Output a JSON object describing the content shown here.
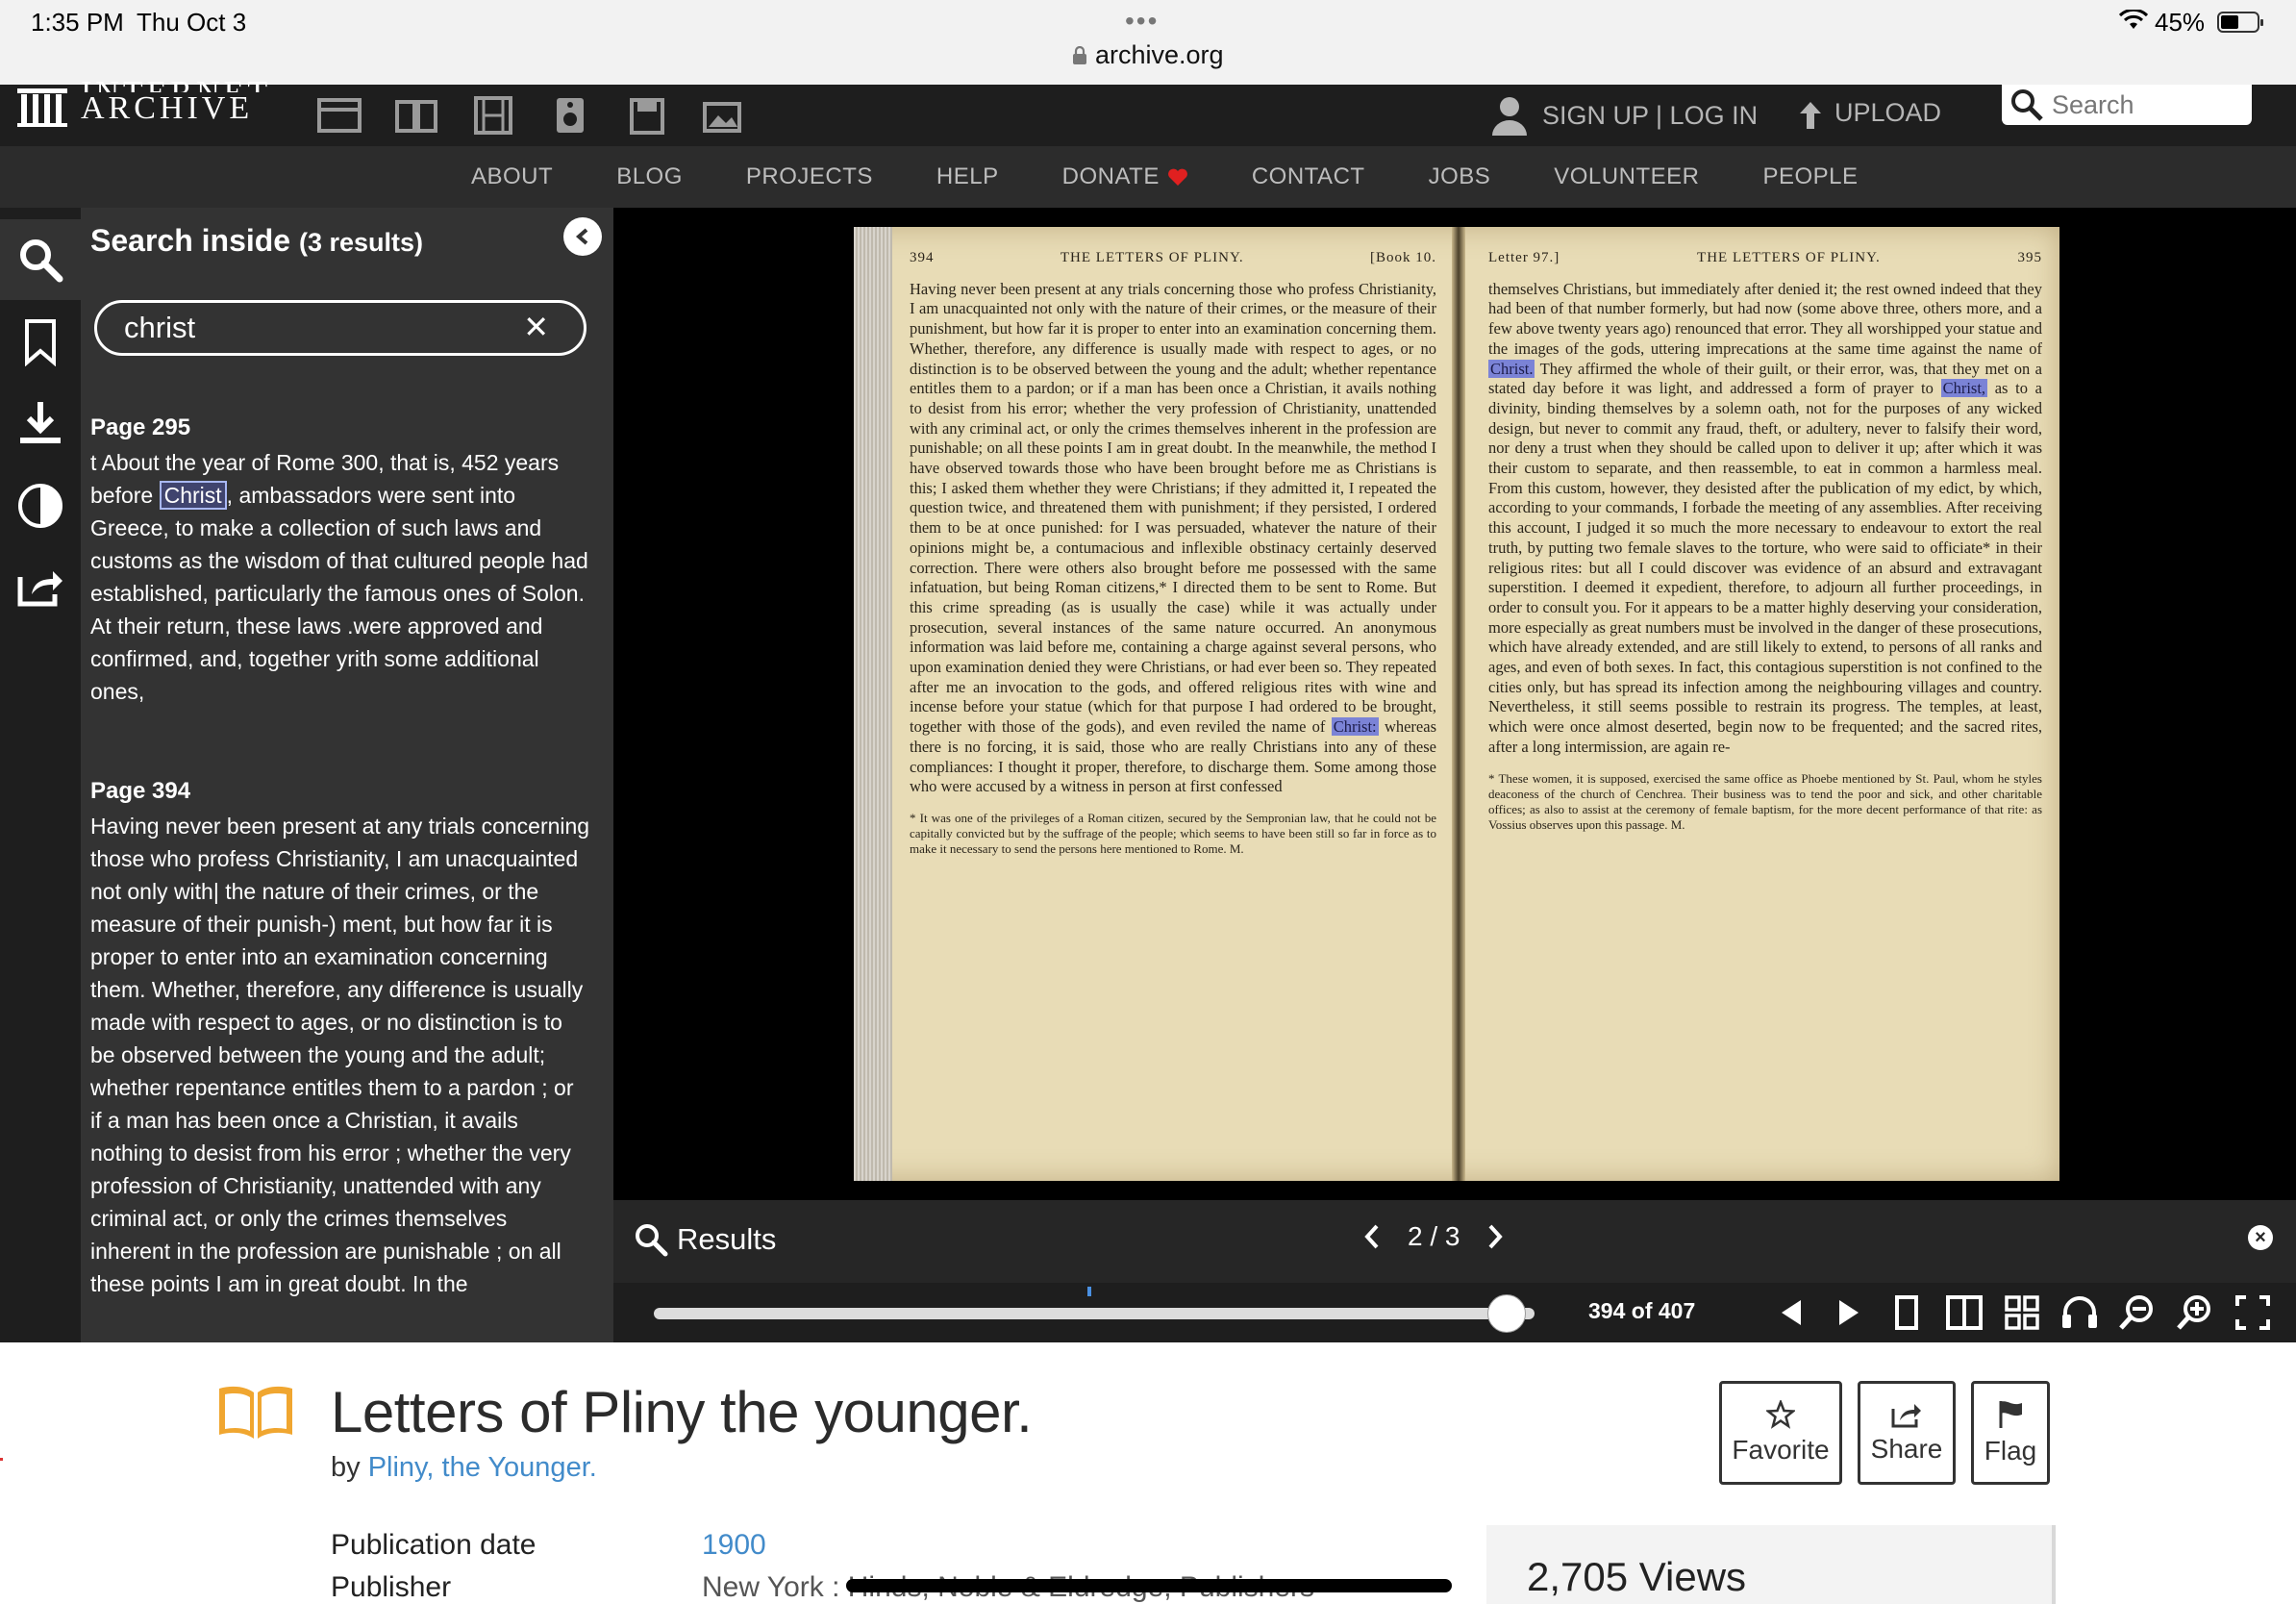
{
  "status_bar": {
    "time": "1:35 PM",
    "date": "Thu Oct 3",
    "url": "archive.org",
    "battery": "45%"
  },
  "ia_header": {
    "logo_line1": "INTERNET",
    "logo_line2": "ARCHIVE",
    "media_icons": [
      "web-icon",
      "texts-icon",
      "video-icon",
      "audio-icon",
      "software-icon",
      "images-icon"
    ],
    "signup_login": "SIGN UP | LOG IN",
    "upload": "UPLOAD",
    "search_placeholder": "Search"
  },
  "nav": {
    "items": [
      "ABOUT",
      "BLOG",
      "PROJECTS",
      "HELP",
      "DONATE",
      "CONTACT",
      "JOBS",
      "VOLUNTEER",
      "PEOPLE"
    ]
  },
  "sidebar": {
    "icons": [
      "search-icon",
      "bookmark-icon",
      "download-icon",
      "contrast-icon",
      "share-icon"
    ]
  },
  "search_panel": {
    "title": "Search inside",
    "count": "(3 results)",
    "query": "christ",
    "results": [
      {
        "page": "Page 295",
        "pre": "t About the year of Rome 300, that is, 452 years before ",
        "match": "Christ",
        "post": ", ambassadors were sent into Greece, to make a collection of such laws and customs as the wisdom of that cultured people had established, particularly the famous ones of Solon. At their return, these laws .were approved and confirmed, and, together yrith some additional ones,"
      },
      {
        "page": "Page 394",
        "text": "Having never been present at any trials concerning those who profess Christianity, I am unacquainted not only with| the nature of their crimes, or the measure of their punish-) ment, but how far it is proper to enter into an examination concerning them. Whether, therefore, any difference is usually made with respect to ages, or no distinction is to be observed between the young and the adult; whether repentance entitles them to a pardon ; or if a man has been once a Christian, it avails nothing to desist from his error ; whether the very profession of Christianity, unattended with any criminal act, or only the crimes themselves inherent in the profession are punishable ; on all these points I am in great doubt. In the"
      }
    ]
  },
  "book": {
    "left_page": {
      "num": "394",
      "running_head": "THE LETTERS OF PLINY.",
      "book_label": "[Book 10.",
      "body_pre": "Having never been present at any trials concerning those who profess Christianity, I am unacquainted not only with the nature of their crimes, or the measure of their punishment, but how far it is proper to enter into an examination concerning them. Whether, therefore, any difference is usually made with respect to ages, or no distinction is to be observed between the young and the adult; whether repentance entitles them to a pardon; or if a man has been once a Christian, it avails nothing to desist from his error; whether the very profession of Christianity, unattended with any criminal act, or only the crimes themselves inherent in the profession are punishable; on all these points I am in great doubt. In the meanwhile, the method I have observed towards those who have been brought before me as Christians is this; I asked them whether they were Christians; if they admitted it, I repeated the question twice, and threatened them with punishment; if they persisted, I ordered them to be at once punished: for I was persuaded, whatever the nature of their opinions might be, a contumacious and inflexible obstinacy certainly deserved correction. There were others also brought before me possessed with the same infatuation, but being Roman citizens,* I directed them to be sent to Rome. But this crime spreading (as is usually the case) while it was actually under prosecution, several instances of the same nature occurred. An anonymous information was laid before me, containing a charge against several persons, who upon examination denied they were Christians, or had ever been so. They repeated after me an invocation to the gods, and offered religious rites with wine and incense before your statue (which for that purpose I had ordered to be brought, together with those of the gods), and even reviled the name of ",
      "match": "Christ:",
      "body_post": " whereas there is no forcing, it is said, those who are really Christians into any of these compliances: I thought it proper, therefore, to discharge them. Some among those who were accused by a witness in person at first confessed",
      "footnote": "* It was one of the privileges of a Roman citizen, secured by the Sempronian law, that he could not be capitally convicted but by the suffrage of the people; which seems to have been still so far in force as to make it necessary to send the persons here mentioned to Rome. M."
    },
    "right_page": {
      "num": "395",
      "letter_label": "Letter 97.]",
      "running_head": "THE LETTERS OF PLINY.",
      "body_pre": "themselves Christians, but immediately after denied it; the rest owned indeed that they had been of that number formerly, but had now (some above three, others more, and a few above twenty years ago) renounced that error. They all worshipped your statue and the images of the gods, uttering imprecations at the same time against the name of ",
      "match1": "Christ.",
      "body_mid": " They affirmed the whole of their guilt, or their error, was, that they met on a stated day before it was light, and addressed a form of prayer to ",
      "match2": "Christ,",
      "body_post": " as to a divinity, binding themselves by a solemn oath, not for the purposes of any wicked design, but never to commit any fraud, theft, or adultery, never to falsify their word, nor deny a trust when they should be called upon to deliver it up; after which it was their custom to separate, and then reassemble, to eat in common a harmless meal. From this custom, however, they desisted after the publication of my edict, by which, according to your commands, I forbade the meeting of any assemblies. After receiving this account, I judged it so much the more necessary to endeavour to extort the real truth, by putting two female slaves to the torture, who were said to officiate* in their religious rites: but all I could discover was evidence of an absurd and extravagant superstition. I deemed it expedient, therefore, to adjourn all further proceedings, in order to consult you. For it appears to be a matter highly deserving your consideration, more especially as great numbers must be involved in the danger of these prosecutions, which have already extended, and are still likely to extend, to persons of all ranks and ages, and even of both sexes. In fact, this contagious superstition is not confined to the cities only, but has spread its infection among the neighbouring villages and country. Nevertheless, it still seems possible to restrain its progress. The temples, at least, which were once almost deserted, begin now to be frequented; and the sacred rites, after a long intermission, are again re-",
      "footnote": "* These women, it is supposed, exercised the same office as Phoebe mentioned by St. Paul, whom he styles deaconess of the church of Cenchrea. Their business was to tend the poor and sick, and other charitable offices; as also to assist at the ceremony of female baptism, for the more decent performance of that rite: as Vossius observes upon this passage. M."
    }
  },
  "results_bar": {
    "label": "Results",
    "position": "2 / 3"
  },
  "controls": {
    "page_label": "394 of 407",
    "progress_fraction": 0.968,
    "marker_fraction": 0.495,
    "icons": [
      "prev-page-icon",
      "next-page-icon",
      "one-page-icon",
      "two-page-icon",
      "thumbnails-icon",
      "read-aloud-icon",
      "zoom-out-icon",
      "zoom-in-icon",
      "fullscreen-icon"
    ]
  },
  "item": {
    "title": "Letters of Pliny the younger.",
    "by_label": "by",
    "author": "Pliny, the Younger.",
    "favorite": "Favorite",
    "share": "Share",
    "flag": "Flag",
    "pub_date_label": "Publication date",
    "pub_date": "1900",
    "publisher_label": "Publisher",
    "publisher": "New York : Hinds, Noble & Eldredge, Publishers",
    "views": "2,705 Views"
  },
  "colors": {
    "accent_blue": "#428bca",
    "book_orange": "#f0a630",
    "donate_heart": "#e02020",
    "panel_gray": "#333333"
  }
}
